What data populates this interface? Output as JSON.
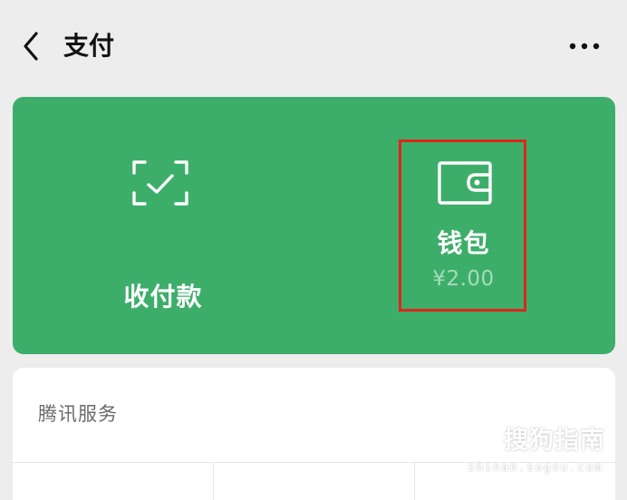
{
  "header": {
    "title": "支付",
    "back_icon": "chevron-left-icon",
    "more_icon": "more-horizontal-icon"
  },
  "pay_card": {
    "background": "#3dae6a",
    "receive": {
      "label": "收付款",
      "icon": "scan-check-icon"
    },
    "wallet": {
      "label": "钱包",
      "balance": "¥2.00",
      "icon": "wallet-icon"
    },
    "highlight_color": "#e0261b"
  },
  "services": {
    "title": "腾讯服务"
  },
  "watermark": {
    "logo_icon": "sogou-logo-icon",
    "text": "搜狗指南",
    "url": "zhinan.sogou.com"
  }
}
